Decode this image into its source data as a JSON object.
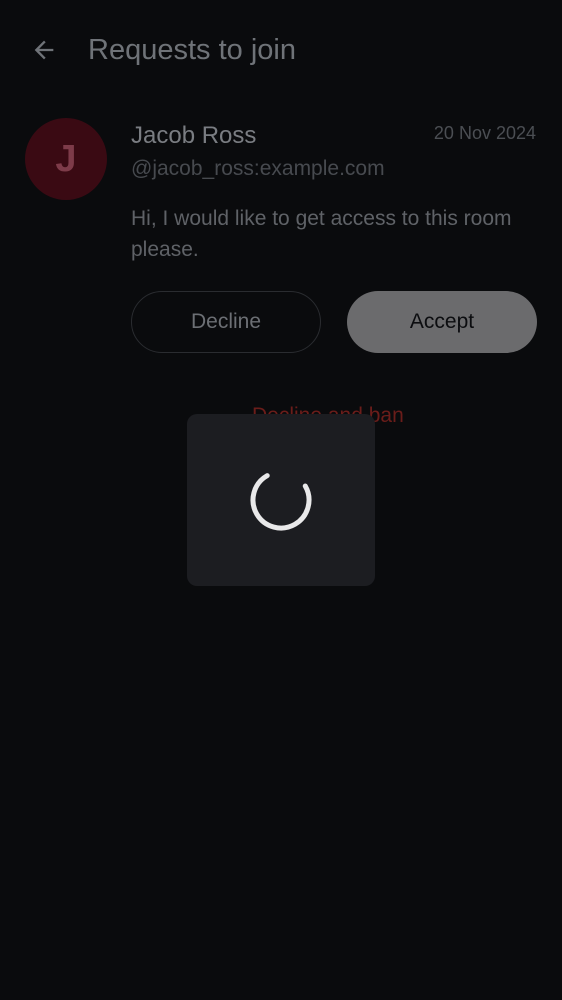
{
  "header": {
    "title": "Requests to join",
    "back_icon": "arrow-back-icon"
  },
  "request": {
    "avatar_letter": "J",
    "name": "Jacob Ross",
    "user_id": "@jacob_ross:example.com",
    "date": "20 Nov 2024",
    "message": "Hi, I would like to get access to this room please.",
    "decline_label": "Decline",
    "accept_label": "Accept",
    "decline_ban_label": "Decline and ban"
  },
  "loading": {
    "icon": "loading-spinner-icon"
  },
  "colors": {
    "background": "#0a0b0d",
    "avatar_bg": "#3a0a13",
    "accept_bg": "#6b6b6d",
    "danger_text": "#6b1d1a",
    "dialog_bg": "#1c1d21"
  }
}
